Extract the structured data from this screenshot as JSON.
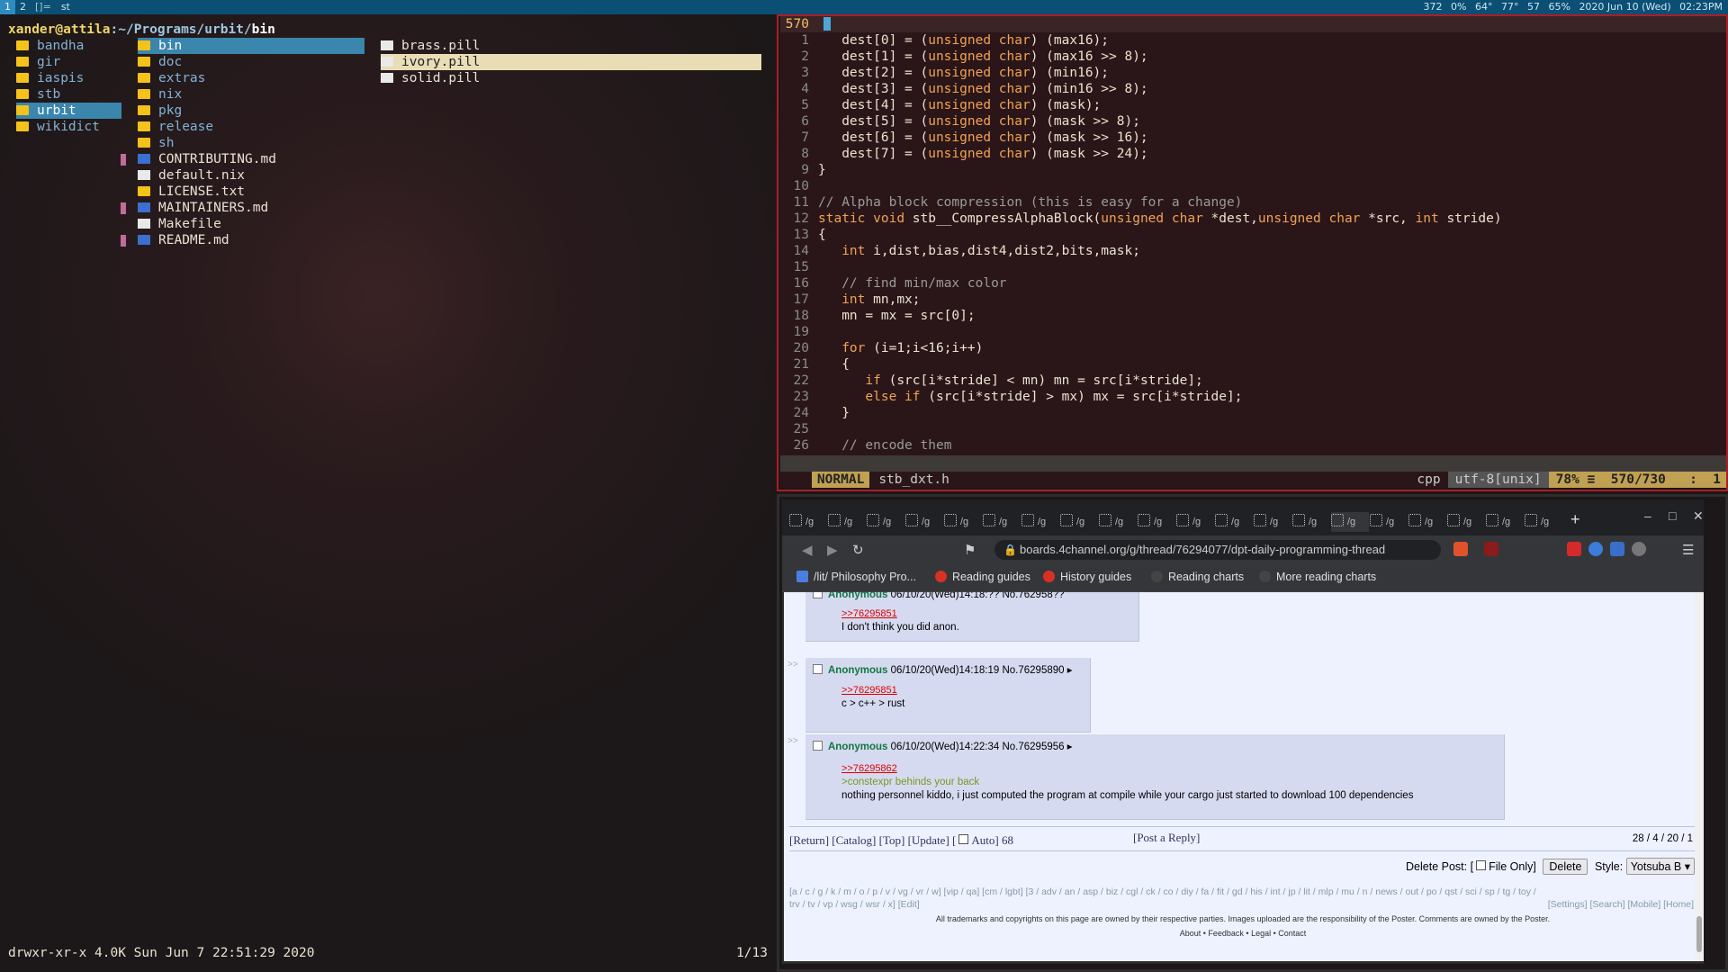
{
  "topbar": {
    "workspaces": [
      "1",
      "2"
    ],
    "layout": "[]=",
    "window_title": "st",
    "status": [
      "372",
      "0%",
      "64°",
      "77°",
      "57",
      "65%",
      "2020 Jun 10 (Wed)",
      "02:23PM"
    ]
  },
  "ranger": {
    "user": "xander@attila",
    "path_dirs": ":~/Programs/urbit/",
    "path_current": "bin",
    "col1": [
      {
        "name": "bandha"
      },
      {
        "name": "gir"
      },
      {
        "name": "iaspis"
      },
      {
        "name": "stb"
      },
      {
        "name": "urbit",
        "selected": true
      },
      {
        "name": "wikidict"
      }
    ],
    "col2": [
      {
        "name": "bin",
        "type": "dir",
        "selected": true
      },
      {
        "name": "doc",
        "type": "dir"
      },
      {
        "name": "extras",
        "type": "dir"
      },
      {
        "name": "nix",
        "type": "dir"
      },
      {
        "name": "pkg",
        "type": "dir"
      },
      {
        "name": "release",
        "type": "dir"
      },
      {
        "name": "sh",
        "type": "dir"
      },
      {
        "name": "CONTRIBUTING.md",
        "type": "md",
        "marked": true
      },
      {
        "name": "default.nix",
        "type": "file"
      },
      {
        "name": "LICENSE.txt",
        "type": "license"
      },
      {
        "name": "MAINTAINERS.md",
        "type": "md",
        "marked": true
      },
      {
        "name": "Makefile",
        "type": "file"
      },
      {
        "name": "README.md",
        "type": "md",
        "marked": true
      }
    ],
    "col3": [
      {
        "name": "brass.pill"
      },
      {
        "name": "ivory.pill",
        "selected": true
      },
      {
        "name": "solid.pill"
      }
    ],
    "footer_info": "drwxr-xr-x 4.0K Sun Jun  7 22:51:29 2020",
    "page": "1/13"
  },
  "vim": {
    "current_line_number": "570",
    "lines": [
      {
        "n": "1",
        "t": "   dest[0] = (unsigned char) (max16);"
      },
      {
        "n": "2",
        "t": "   dest[1] = (unsigned char) (max16 >> 8);"
      },
      {
        "n": "3",
        "t": "   dest[2] = (unsigned char) (min16);"
      },
      {
        "n": "4",
        "t": "   dest[3] = (unsigned char) (min16 >> 8);"
      },
      {
        "n": "5",
        "t": "   dest[4] = (unsigned char) (mask);"
      },
      {
        "n": "6",
        "t": "   dest[5] = (unsigned char) (mask >> 8);"
      },
      {
        "n": "7",
        "t": "   dest[6] = (unsigned char) (mask >> 16);"
      },
      {
        "n": "8",
        "t": "   dest[7] = (unsigned char) (mask >> 24);"
      },
      {
        "n": "9",
        "t": "}"
      },
      {
        "n": "10",
        "t": ""
      },
      {
        "n": "11",
        "t": "// Alpha block compression (this is easy for a change)"
      },
      {
        "n": "12",
        "t": "static void stb__CompressAlphaBlock(unsigned char *dest,unsigned char *src, int stride)"
      },
      {
        "n": "13",
        "t": "{"
      },
      {
        "n": "14",
        "t": "   int i,dist,bias,dist4,dist2,bits,mask;"
      },
      {
        "n": "15",
        "t": ""
      },
      {
        "n": "16",
        "t": "   // find min/max color"
      },
      {
        "n": "17",
        "t": "   int mn,mx;"
      },
      {
        "n": "18",
        "t": "   mn = mx = src[0];"
      },
      {
        "n": "19",
        "t": ""
      },
      {
        "n": "20",
        "t": "   for (i=1;i<16;i++)"
      },
      {
        "n": "21",
        "t": "   {"
      },
      {
        "n": "22",
        "t": "      if (src[i*stride] < mn) mn = src[i*stride];"
      },
      {
        "n": "23",
        "t": "      else if (src[i*stride] > mx) mx = src[i*stride];"
      },
      {
        "n": "24",
        "t": "   }"
      },
      {
        "n": "25",
        "t": ""
      },
      {
        "n": "26",
        "t": "   // encode them"
      }
    ],
    "mode": "NORMAL",
    "filename": "stb_dxt.h",
    "filetype": "cpp",
    "encoding": "utf-8[unix]",
    "percent": "78%",
    "position": "570/730",
    "column": ":  1"
  },
  "browser": {
    "tab_label": "/g",
    "url": "boards.4channel.org/g/thread/76294077/dpt-daily-programming-thread",
    "bookmarks": [
      "/lit/ Philosophy Pro...",
      "Reading guides",
      "History guides",
      "Reading charts",
      "More reading charts"
    ],
    "posts": [
      {
        "name": "Anonymous",
        "meta": "06/10/20(Wed)14:18:?? No.762958??",
        "quote": ">>76295851",
        "body": "I don't think you did anon."
      },
      {
        "name": "Anonymous",
        "meta": "06/10/20(Wed)14:18:19 No.76295890",
        "quote": ">>76295851",
        "body": "c > c++ > rust"
      },
      {
        "name": "Anonymous",
        "meta": "06/10/20(Wed)14:22:34 No.76295956",
        "quote": ">>76295862",
        "greentext": ">constexpr behinds your back",
        "body": "nothing personnel kiddo, i just computed the program at compile while your cargo just started to download 100 dependencies"
      }
    ],
    "navline": "[Return] [Catalog] [Top] [Update] [",
    "auto_label": "Auto] 68",
    "post_reply": "[Post a Reply]",
    "stats": "28 / 4 / 20 / 1",
    "delete_label": "Delete Post: [",
    "file_only": "File Only]",
    "delete_button": "Delete",
    "style_label": "Style:",
    "style_value": "Yotsuba B",
    "boards_line1": "[a / c / g / k / m / o / p / v / vg / vr / w] [vip / qa] [cm / lgbt] [3 / adv / an / asp / biz / cgl / ck / co / diy / fa / fit / gd / his / int / jp / lit / mlp / mu / n / news / out / po / qst / sci / sp / tg / toy /",
    "boards_line2": "trv / tv / vp / wsg / wsr / x] [Edit]",
    "boards_right": "[Settings] [Search] [Mobile] [Home]",
    "legal": "All trademarks and copyrights on this page are owned by their respective parties. Images uploaded are the responsibility of the Poster. Comments are owned by the Poster.",
    "legal_links": "About • Feedback • Legal • Contact"
  }
}
